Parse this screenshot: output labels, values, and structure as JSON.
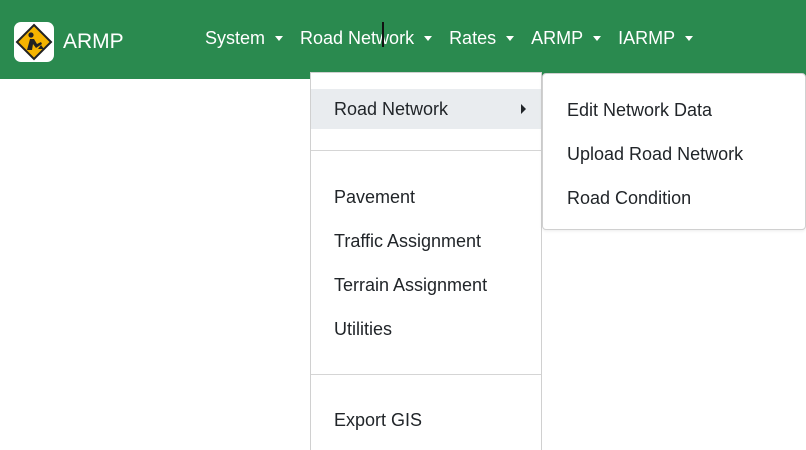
{
  "brand": {
    "name": "ARMP",
    "logo_icon": "road-work-sign-icon"
  },
  "nav": [
    {
      "label": "System"
    },
    {
      "label": "Road Network"
    },
    {
      "label": "Rates"
    },
    {
      "label": "ARMP"
    },
    {
      "label": "IARMP"
    }
  ],
  "dropdown": {
    "active": "Road Network",
    "items": [
      {
        "label": "Road Network"
      },
      {
        "label": "Pavement"
      },
      {
        "label": "Traffic Assignment"
      },
      {
        "label": "Terrain Assignment"
      },
      {
        "label": "Utilities"
      },
      {
        "label": "Export GIS"
      }
    ]
  },
  "submenu": {
    "items": [
      {
        "label": "Edit Network Data"
      },
      {
        "label": "Upload Road Network"
      },
      {
        "label": "Road Condition"
      }
    ]
  },
  "colors": {
    "navbar": "#2a8a4f",
    "active_item": "#e9ecef",
    "logo_sign": "#f5b400"
  }
}
